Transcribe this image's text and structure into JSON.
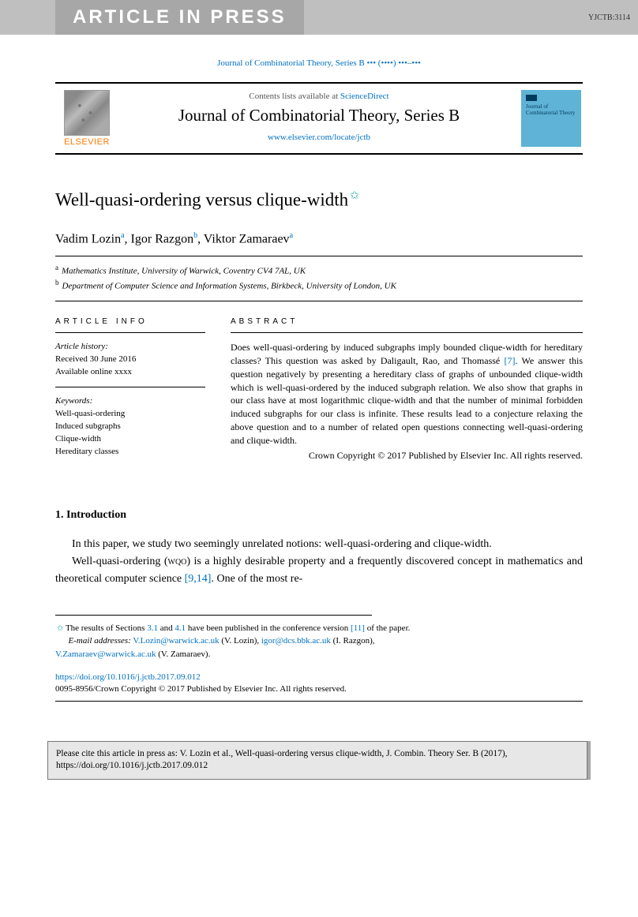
{
  "banner": {
    "text": "ARTICLE IN PRESS",
    "code": "YJCTB:3114"
  },
  "citation_line": "Journal of Combinatorial Theory, Series B ••• (••••) •••–•••",
  "header": {
    "contents_prefix": "Contents lists available at ",
    "contents_link": "ScienceDirect",
    "journal_name": "Journal of Combinatorial Theory, Series B",
    "journal_url": "www.elsevier.com/locate/jctb",
    "publisher": "ELSEVIER",
    "cover_text": "Journal of Combinatorial Theory"
  },
  "article": {
    "title": "Well-quasi-ordering versus clique-width",
    "star": "✩",
    "authors": [
      {
        "name": "Vadim Lozin",
        "aff": "a"
      },
      {
        "name": "Igor Razgon",
        "aff": "b"
      },
      {
        "name": "Viktor Zamaraev",
        "aff": "a"
      }
    ],
    "authors_line_1": "Vadim Lozin",
    "authors_line_1_sup": "a",
    "authors_line_2": ", Igor Razgon",
    "authors_line_2_sup": "b",
    "authors_line_3": ", Viktor Zamaraev",
    "authors_line_3_sup": "a",
    "affiliations": {
      "a": "Mathematics Institute, University of Warwick, Coventry CV4 7AL, UK",
      "b": "Department of Computer Science and Information Systems, Birkbeck, University of London, UK"
    }
  },
  "info": {
    "heading": "ARTICLE INFO",
    "history_label": "Article history:",
    "received": "Received 30 June 2016",
    "available": "Available online xxxx",
    "keywords_label": "Keywords:",
    "keywords": [
      "Well-quasi-ordering",
      "Induced subgraphs",
      "Clique-width",
      "Hereditary classes"
    ]
  },
  "abstract": {
    "heading": "ABSTRACT",
    "text": "Does well-quasi-ordering by induced subgraphs imply bounded clique-width for hereditary classes? This question was asked by Daligault, Rao, and Thomassé [7]. We answer this question negatively by presenting a hereditary class of graphs of unbounded clique-width which is well-quasi-ordered by the induced subgraph relation. We also show that graphs in our class have at most logarithmic clique-width and that the number of minimal forbidden induced subgraphs for our class is infinite. These results lead to a conjecture relaxing the above question and to a number of related open questions connecting well-quasi-ordering and clique-width.",
    "ref7": "[7]",
    "copyright": "Crown Copyright © 2017 Published by Elsevier Inc. All rights reserved."
  },
  "body": {
    "section_num": "1.",
    "section_title": "Introduction",
    "para1": "In this paper, we study two seemingly unrelated notions: well-quasi-ordering and clique-width.",
    "para2_a": "Well-quasi-ordering (",
    "para2_wqo": "wqo",
    "para2_b": ") is a highly desirable property and a frequently discovered concept in mathematics and theoretical computer science ",
    "para2_ref": "[9,14]",
    "para2_c": ". One of the most re-"
  },
  "footnotes": {
    "star_a": "The results of Sections ",
    "star_ref1": "3.1",
    "star_mid": " and ",
    "star_ref2": "4.1",
    "star_b": " have been published in the conference version ",
    "star_ref3": "[11]",
    "star_c": " of the paper.",
    "email_label": "E-mail addresses:",
    "email1": "V.Lozin@warwick.ac.uk",
    "email1_who": " (V. Lozin), ",
    "email2": "igor@dcs.bbk.ac.uk",
    "email2_who": " (I. Razgon),",
    "email3": "V.Zamaraev@warwick.ac.uk",
    "email3_who": " (V. Zamaraev)."
  },
  "doi": {
    "url": "https://doi.org/10.1016/j.jctb.2017.09.012",
    "line": "0095-8956/Crown Copyright © 2017 Published by Elsevier Inc. All rights reserved."
  },
  "bottom_box": "Please cite this article in press as: V. Lozin et al., Well-quasi-ordering versus clique-width, J. Combin. Theory Ser. B (2017), https://doi.org/10.1016/j.jctb.2017.09.012"
}
